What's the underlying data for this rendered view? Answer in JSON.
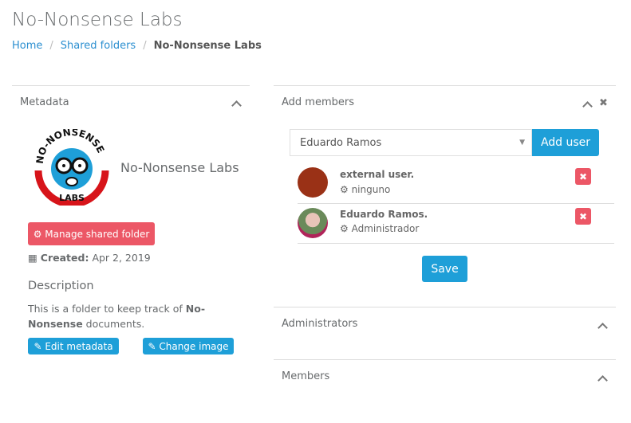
{
  "page": {
    "title": "No-Nonsense Labs"
  },
  "breadcrumb": [
    {
      "label": "Home"
    },
    {
      "label": "Shared folders"
    },
    {
      "label": "No-Nonsense Labs"
    }
  ],
  "metadata": {
    "header": "Metadata",
    "logo_text": "NO-NONSENSE LABS",
    "folder_name": "No-Nonsense Labs",
    "manage_label": "Manage shared folder",
    "created_label": "Created:",
    "created_value": "Apr 2, 2019",
    "description_heading": "Description",
    "description_pre": "This is a folder to keep track of ",
    "description_bold": "No-Nonsense",
    "description_post": " documents.",
    "edit_label": "Edit metadata",
    "change_image_label": "Change image"
  },
  "add_members": {
    "header": "Add members",
    "select_value": "Eduardo Ramos",
    "add_label": "Add user",
    "save_label": "Save",
    "members": [
      {
        "name": "external user.",
        "role": "ninguno",
        "avatar_color": "#9a3116"
      },
      {
        "name": "Eduardo Ramos.",
        "role": "Administrador",
        "avatar_color": "#b08a82"
      }
    ]
  },
  "sections": {
    "administrators": "Administrators",
    "members": "Members"
  },
  "colors": {
    "primary": "#1e9fd8",
    "danger": "#ec5766"
  }
}
